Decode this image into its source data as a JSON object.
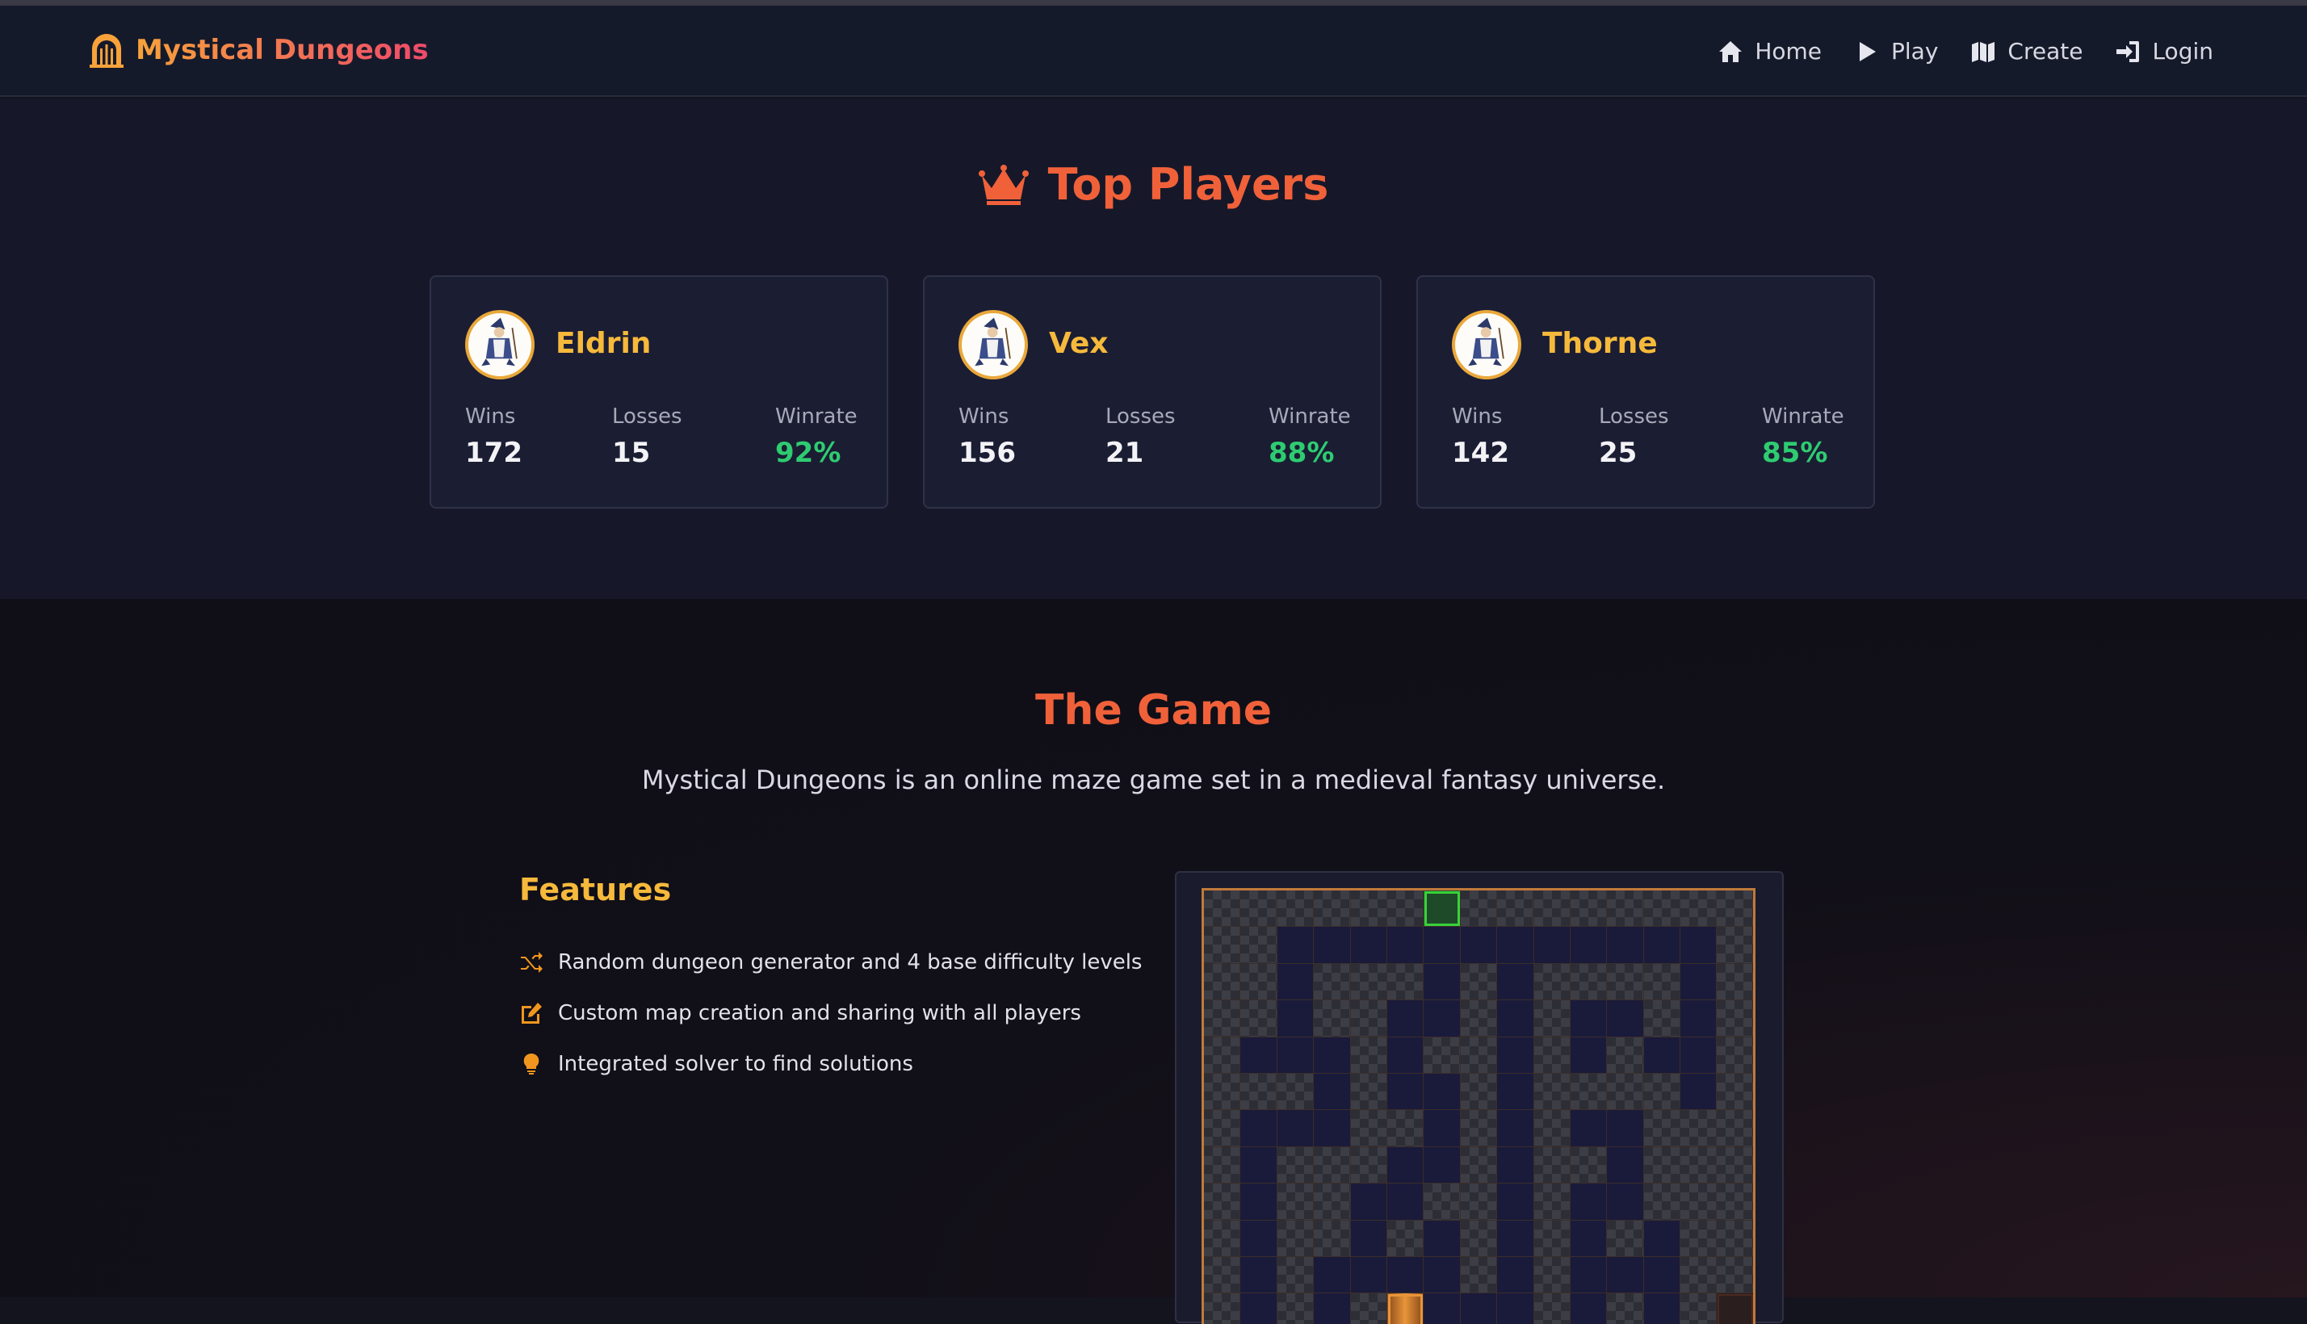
{
  "nav": {
    "brand": "Mystical Dungeons",
    "links": [
      {
        "label": "Home",
        "icon": "home-icon"
      },
      {
        "label": "Play",
        "icon": "play-icon"
      },
      {
        "label": "Create",
        "icon": "map-icon"
      },
      {
        "label": "Login",
        "icon": "login-icon"
      }
    ]
  },
  "top_players": {
    "title": "Top Players",
    "stat_labels": {
      "wins": "Wins",
      "losses": "Losses",
      "winrate": "Winrate"
    },
    "players": [
      {
        "name": "Eldrin",
        "wins": "172",
        "losses": "15",
        "winrate": "92%"
      },
      {
        "name": "Vex",
        "wins": "156",
        "losses": "21",
        "winrate": "88%"
      },
      {
        "name": "Thorne",
        "wins": "142",
        "losses": "25",
        "winrate": "85%"
      }
    ]
  },
  "game": {
    "title": "The Game",
    "description": "Mystical Dungeons is an online maze game set in a medieval fantasy universe.",
    "features_title": "Features",
    "features": [
      {
        "text": "Random dungeon generator and 4 base difficulty levels",
        "icon": "shuffle-icon"
      },
      {
        "text": "Custom map creation and sharing with all players",
        "icon": "edit-icon"
      },
      {
        "text": "Integrated solver to find solutions",
        "icon": "lightbulb-icon"
      }
    ]
  },
  "maze": {
    "rows": [
      "WWWWWWSWWWWWWWW",
      "WWPPPPPPPPPPPPW",
      "WWPWWWPWPWWWWPW",
      "WWPWWPPWPWPPWPW",
      "WPPPWPWWPWPWPPW",
      "WWWPWPPWPWWWWPW",
      "WPPPWWPWPWPPWWW",
      "WPWWWPPWPWWPWWW",
      "WPWWPPWWPWPPWWW",
      "WPWWPWPWPWPWPWW",
      "WPWPPPPWPWPPPWW",
      "WPWPWXPPPWPWPWE"
    ]
  },
  "colors": {
    "accent": "#f0613a",
    "gold": "#f6b93b",
    "winrate": "#2ecc71",
    "background": "#14141f"
  }
}
